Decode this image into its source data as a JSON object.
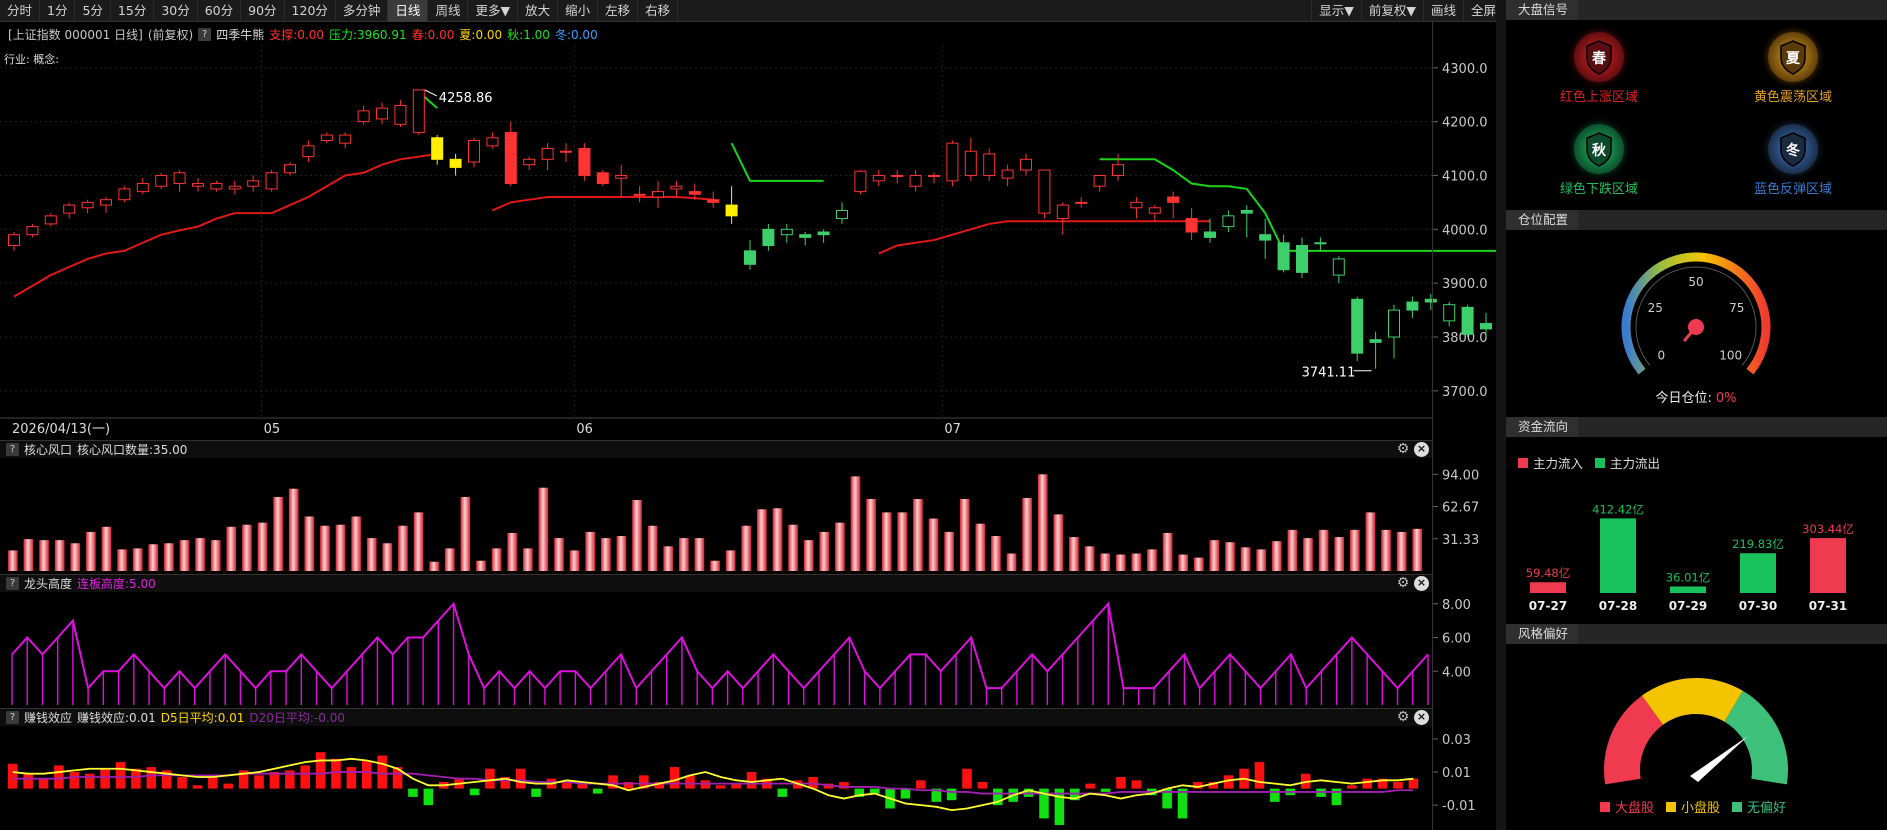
{
  "toolbar": {
    "left_buttons": [
      "分时",
      "1分",
      "5分",
      "15分",
      "30分",
      "60分",
      "90分",
      "120分",
      "多分钟",
      "日线",
      "周线",
      "更多▼",
      "放大",
      "缩小",
      "左移",
      "右移"
    ],
    "active": "日线",
    "right_buttons": [
      "显示▼",
      "前复权▼",
      "画线",
      "全屏"
    ]
  },
  "info": {
    "index": "[上证指数 000001 日线]",
    "adjust": "(前复权)",
    "help": "?",
    "indicator": "四季牛熊",
    "support": "支撑:0.00",
    "pressure": "压力:3960.91",
    "spring": "春:0.00",
    "summer": "夏:0.00",
    "autumn": "秋:1.00",
    "winter": "冬:0.00",
    "industry": "行业: 概念:"
  },
  "main_chart": {
    "y_ticks": [
      "4300.0",
      "4200.0",
      "4100.0",
      "4000.0",
      "3900.0",
      "3800.0",
      "3700.0"
    ],
    "y_vals": [
      4300,
      4200,
      4100,
      4000,
      3900,
      3800,
      3700
    ],
    "ymin": 3670,
    "ymax": 4320,
    "high_label": "4258.86",
    "low_label": "3741.11",
    "date_label": "2026/04/13(一)",
    "months": [
      "05",
      "06",
      "07"
    ],
    "month_index": [
      14,
      31,
      51
    ],
    "candles": [
      [
        3970,
        3990,
        3960,
        3995,
        "r"
      ],
      [
        3990,
        4005,
        3985,
        4010,
        "r"
      ],
      [
        4010,
        4025,
        4005,
        4030,
        "r"
      ],
      [
        4030,
        4045,
        4020,
        4050,
        "r"
      ],
      [
        4040,
        4050,
        4030,
        4055,
        "r"
      ],
      [
        4045,
        4055,
        4030,
        4060,
        "r"
      ],
      [
        4055,
        4075,
        4050,
        4080,
        "r"
      ],
      [
        4070,
        4085,
        4065,
        4095,
        "r"
      ],
      [
        4080,
        4100,
        4075,
        4105,
        "r"
      ],
      [
        4085,
        4105,
        4070,
        4110,
        "r"
      ],
      [
        4080,
        4085,
        4070,
        4095,
        "r"
      ],
      [
        4075,
        4085,
        4070,
        4090,
        "r"
      ],
      [
        4075,
        4080,
        4065,
        4090,
        "r"
      ],
      [
        4080,
        4090,
        4070,
        4100,
        "r"
      ],
      [
        4075,
        4105,
        4070,
        4110,
        "r"
      ],
      [
        4105,
        4120,
        4100,
        4125,
        "r"
      ],
      [
        4135,
        4155,
        4125,
        4165,
        "r"
      ],
      [
        4165,
        4175,
        4160,
        4180,
        "r"
      ],
      [
        4160,
        4175,
        4150,
        4180,
        "r"
      ],
      [
        4200,
        4220,
        4195,
        4230,
        "r"
      ],
      [
        4205,
        4225,
        4195,
        4235,
        "r"
      ],
      [
        4195,
        4230,
        4190,
        4240,
        "r"
      ],
      [
        4180,
        4258.86,
        4175,
        4260,
        "r"
      ],
      [
        4170,
        4130,
        4120,
        4175,
        "y"
      ],
      [
        4115,
        4130,
        4100,
        4140,
        "y"
      ],
      [
        4125,
        4165,
        4115,
        4170,
        "r"
      ],
      [
        4155,
        4170,
        4150,
        4180,
        "r"
      ],
      [
        4180,
        4085,
        4080,
        4200,
        "r"
      ],
      [
        4120,
        4130,
        4110,
        4135,
        "r"
      ],
      [
        4130,
        4150,
        4110,
        4160,
        "r"
      ],
      [
        4145,
        4145,
        4125,
        4160,
        "r"
      ],
      [
        4150,
        4100,
        4090,
        4160,
        "r"
      ],
      [
        4105,
        4085,
        4080,
        4110,
        "r"
      ],
      [
        4095,
        4100,
        4060,
        4120,
        "r"
      ],
      [
        4065,
        4065,
        4050,
        4080,
        "r"
      ],
      [
        4060,
        4070,
        4040,
        4090,
        "r"
      ],
      [
        4075,
        4080,
        4060,
        4090,
        "r"
      ],
      [
        4070,
        4065,
        4055,
        4085,
        "r"
      ],
      [
        4055,
        4050,
        4040,
        4070,
        "r"
      ],
      [
        4045,
        4025,
        4010,
        4080,
        "y"
      ],
      [
        3935,
        3960,
        3925,
        3980,
        "g"
      ],
      [
        3970,
        4000,
        3960,
        4010,
        "g"
      ],
      [
        3990,
        4000,
        3975,
        4010,
        "g"
      ],
      [
        3985,
        3990,
        3970,
        3995,
        "g"
      ],
      [
        3990,
        3995,
        3975,
        4000,
        "g"
      ],
      [
        4020,
        4035,
        4010,
        4050,
        "g"
      ],
      [
        4070,
        4108,
        4065,
        4110,
        "r"
      ],
      [
        4090,
        4100,
        4080,
        4110,
        "r"
      ],
      [
        4100,
        4100,
        4085,
        4110,
        "r"
      ],
      [
        4080,
        4100,
        4070,
        4110,
        "r"
      ],
      [
        4100,
        4100,
        4085,
        4105,
        "r"
      ],
      [
        4090,
        4160,
        4080,
        4165,
        "r"
      ],
      [
        4100,
        4145,
        4090,
        4170,
        "r"
      ],
      [
        4100,
        4140,
        4090,
        4150,
        "r"
      ],
      [
        4095,
        4110,
        4080,
        4120,
        "r"
      ],
      [
        4110,
        4130,
        4100,
        4140,
        "r"
      ],
      [
        4030,
        4110,
        4020,
        4110,
        "r"
      ],
      [
        4020,
        4045,
        3990,
        4050,
        "r"
      ],
      [
        4050,
        4050,
        4040,
        4060,
        "r"
      ],
      [
        4080,
        4100,
        4070,
        4100,
        "r"
      ],
      [
        4100,
        4120,
        4090,
        4140,
        "r"
      ],
      [
        4040,
        4050,
        4020,
        4060,
        "r"
      ],
      [
        4030,
        4040,
        4015,
        4045,
        "r"
      ],
      [
        4060,
        4050,
        4020,
        4070,
        "r"
      ],
      [
        4020,
        3995,
        3980,
        4040,
        "r"
      ],
      [
        3985,
        3995,
        3975,
        4020,
        "g"
      ],
      [
        4005,
        4025,
        3995,
        4035,
        "g"
      ],
      [
        4030,
        4035,
        3985,
        4045,
        "g"
      ],
      [
        3990,
        3980,
        3945,
        4020,
        "g"
      ],
      [
        3975,
        3925,
        3920,
        3990,
        "g"
      ],
      [
        3970,
        3920,
        3910,
        3985,
        "g"
      ],
      [
        3975,
        3975,
        3960,
        3985,
        "g"
      ],
      [
        3915,
        3945,
        3900,
        3950,
        "g"
      ],
      [
        3770,
        3870,
        3755,
        3875,
        "g"
      ],
      [
        3790,
        3795,
        3741.11,
        3810,
        "g"
      ],
      [
        3800,
        3850,
        3760,
        3860,
        "g"
      ],
      [
        3850,
        3865,
        3835,
        3875,
        "g"
      ],
      [
        3865,
        3870,
        3850,
        3880,
        "g"
      ],
      [
        3830,
        3860,
        3820,
        3865,
        "g"
      ],
      [
        3805,
        3855,
        3800,
        3860,
        "g"
      ],
      [
        3825,
        3815,
        3800,
        3845,
        "g"
      ],
      [
        3825,
        3835,
        3800,
        3845,
        "g"
      ],
      [
        3805,
        3815,
        3770,
        3830,
        "g"
      ],
      [
        3830,
        3840,
        3820,
        3850,
        "g"
      ]
    ],
    "red_line": [
      3875,
      3895,
      3915,
      3930,
      3945,
      3955,
      3960,
      3975,
      3990,
      3998,
      4005,
      4020,
      4030,
      4030,
      4030,
      4045,
      4060,
      4080,
      4100,
      4105,
      4120,
      4130,
      4135,
      4140,
      null,
      null,
      4035,
      4050,
      4055,
      4060,
      4060,
      4060,
      4060,
      4060,
      4060,
      4060,
      4060,
      4058,
      4055,
      null,
      null,
      null,
      null,
      null,
      null,
      null,
      null,
      3955,
      3970,
      3975,
      3980,
      3990,
      4000,
      4010,
      4015,
      4015,
      4015,
      4015,
      4015,
      4015,
      4015,
      4015,
      4015,
      4015,
      4015,
      4015
    ],
    "green_line": [
      null,
      null,
      null,
      null,
      null,
      null,
      null,
      null,
      null,
      null,
      null,
      null,
      null,
      null,
      null,
      null,
      null,
      null,
      null,
      null,
      null,
      null,
      4255,
      4225,
      null,
      null,
      null,
      null,
      null,
      null,
      null,
      null,
      null,
      null,
      null,
      null,
      null,
      null,
      null,
      4160,
      4090,
      4090,
      4090,
      4090,
      4090,
      null,
      null,
      null,
      null,
      null,
      null,
      null,
      null,
      null,
      null,
      null,
      null,
      null,
      null,
      4130,
      4130,
      4130,
      4130,
      4110,
      4085,
      4080,
      4080,
      4075,
      4030,
      3960,
      3960,
      3960,
      3960,
      3960,
      3960,
      3960,
      3960,
      3960,
      3960,
      3960,
      3960,
      3960,
      3958
    ]
  },
  "sub1": {
    "help": "?",
    "title": "核心风口",
    "value_label": "核心风口数量:35.00",
    "y_ticks": [
      "94.00",
      "62.67",
      "31.33"
    ],
    "y_vals": [
      94,
      62.67,
      31.33
    ],
    "ymax": 105,
    "values": [
      20,
      31,
      30,
      30,
      27,
      38,
      43,
      21,
      22,
      26,
      27,
      30,
      32,
      30,
      43,
      45,
      47,
      72,
      80,
      53,
      44,
      45,
      53,
      32,
      27,
      44,
      57,
      9,
      22,
      72,
      10,
      22,
      37,
      22,
      81,
      32,
      20,
      38,
      32,
      34,
      69,
      44,
      24,
      32,
      32,
      10,
      20,
      44,
      60,
      61,
      45,
      30,
      38,
      47,
      92,
      70,
      57,
      57,
      70,
      51,
      38,
      70,
      46,
      34,
      17,
      71,
      94,
      55,
      33,
      24,
      17,
      16,
      17,
      21,
      37,
      16,
      13,
      30,
      28,
      23,
      21,
      29,
      40,
      32,
      40,
      33,
      40,
      57,
      40,
      38,
      41
    ]
  },
  "sub2": {
    "help": "?",
    "title": "龙头高度",
    "value_label": "连板高度:5.00",
    "y_ticks": [
      "8.00",
      "6.00",
      "4.00"
    ],
    "y_vals": [
      8,
      6,
      4
    ],
    "ymin": 2,
    "ymax": 8.4,
    "values": [
      5,
      6,
      5,
      6,
      7,
      3,
      4,
      4,
      5,
      4,
      3,
      4,
      3,
      4,
      5,
      4,
      3,
      4,
      4,
      5,
      4,
      3,
      4,
      5,
      6,
      5,
      6,
      6,
      7,
      8,
      5,
      3,
      4,
      3,
      4,
      3,
      4,
      4,
      3,
      4,
      5,
      3,
      4,
      5,
      6,
      4,
      3,
      4,
      3,
      4,
      5,
      4,
      3,
      4,
      5,
      6,
      4,
      3,
      4,
      5,
      5,
      4,
      5,
      6,
      3,
      3,
      4,
      5,
      4,
      5,
      6,
      7,
      8,
      3,
      3,
      3,
      4,
      5,
      3,
      4,
      5,
      4,
      3,
      4,
      5,
      3,
      4,
      5,
      6,
      5,
      4,
      3,
      4,
      5
    ]
  },
  "sub3": {
    "help": "?",
    "title": "赚钱效应",
    "value_label": "赚钱效应:0.01",
    "d5": "D5日平均:0.01",
    "d20": "D20日平均:-0.00",
    "y_ticks": [
      "0.03",
      "0.01",
      "-0.01"
    ],
    "y_vals": [
      0.03,
      0.01,
      -0.01
    ],
    "ymin": -0.025,
    "ymax": 0.036,
    "values": [
      0.015,
      0.009,
      0.006,
      0.014,
      0.01,
      0.009,
      0.012,
      0.016,
      0.012,
      0.013,
      0.011,
      0.007,
      0.002,
      0.007,
      0.003,
      0.011,
      0.008,
      0.01,
      0.011,
      0.014,
      0.022,
      0.018,
      0.013,
      0.017,
      0.02,
      0.013,
      -0.005,
      -0.01,
      0.004,
      0.006,
      -0.004,
      0.012,
      0.007,
      0.012,
      -0.005,
      0.006,
      0.004,
      0.004,
      -0.003,
      0.008,
      0.004,
      0.008,
      0.004,
      0.013,
      0.008,
      0.005,
      0.002,
      0.003,
      0.01,
      0.006,
      -0.005,
      0.005,
      0.007,
      0.003,
      0.004,
      -0.005,
      -0.003,
      -0.012,
      -0.006,
      0.005,
      -0.008,
      -0.007,
      0.012,
      0.004,
      -0.01,
      -0.008,
      -0.005,
      -0.018,
      -0.022,
      -0.007,
      0.003,
      -0.002,
      0.007,
      0.005,
      -0.004,
      -0.012,
      -0.018,
      0.004,
      0.004,
      0.008,
      0.012,
      0.016,
      -0.008,
      -0.004,
      0.009,
      -0.005,
      -0.01,
      0.002,
      0.006,
      0.006,
      0.004,
      0.006
    ],
    "d5_line": [
      0.01,
      0.009,
      0.009,
      0.01,
      0.011,
      0.012,
      0.012,
      0.012,
      0.011,
      0.01,
      0.009,
      0.008,
      0.007,
      0.007,
      0.008,
      0.009,
      0.01,
      0.012,
      0.014,
      0.016,
      0.017,
      0.017,
      0.018,
      0.017,
      0.015,
      0.012,
      0.006,
      0.002,
      0.002,
      0.003,
      0.004,
      0.005,
      0.006,
      0.004,
      0.003,
      0.003,
      0.005,
      0.004,
      0.003,
      0.002,
      -0.001,
      0.001,
      0.003,
      0.005,
      0.008,
      0.01,
      0.007,
      0.005,
      0.004,
      0.005,
      0.006,
      0.003,
      0.0,
      -0.004,
      -0.006,
      -0.004,
      -0.003,
      -0.006,
      -0.009,
      -0.01,
      -0.011,
      -0.013,
      -0.012,
      -0.01,
      -0.008,
      -0.004,
      -0.001,
      -0.003,
      -0.005,
      -0.006,
      -0.003,
      -0.004,
      -0.006,
      -0.004,
      -0.003,
      0.0,
      0.002,
      0.001,
      0.003,
      0.005,
      0.006,
      0.004,
      0.003,
      0.002,
      0.004,
      0.005,
      0.004,
      0.003,
      0.004,
      0.005,
      0.005,
      0.006
    ],
    "d20_line": [
      0.006,
      0.006,
      0.006,
      0.006,
      0.007,
      0.007,
      0.007,
      0.007,
      0.007,
      0.008,
      0.008,
      0.008,
      0.008,
      0.008,
      0.008,
      0.009,
      0.009,
      0.009,
      0.009,
      0.009,
      0.009,
      0.01,
      0.01,
      0.01,
      0.009,
      0.009,
      0.009,
      0.008,
      0.007,
      0.006,
      0.006,
      0.005,
      0.005,
      0.005,
      0.004,
      0.004,
      0.004,
      0.003,
      0.003,
      0.003,
      0.003,
      0.003,
      0.003,
      0.003,
      0.003,
      0.003,
      0.003,
      0.003,
      0.003,
      0.003,
      0.003,
      0.003,
      0.003,
      0.002,
      0.001,
      0.001,
      0.001,
      0.0,
      0.0,
      -0.001,
      -0.001,
      -0.002,
      -0.002,
      -0.003,
      -0.003,
      -0.003,
      -0.003,
      -0.003,
      -0.003,
      -0.003,
      -0.003,
      -0.003,
      -0.002,
      -0.002,
      -0.002,
      -0.002,
      -0.002,
      -0.002,
      -0.002,
      -0.002,
      -0.002,
      -0.002,
      -0.002,
      -0.002,
      -0.002,
      -0.002,
      -0.002,
      -0.002,
      -0.002,
      -0.002,
      -0.001,
      -0.001
    ]
  },
  "right": {
    "signal_title": "大盘信号",
    "signals": [
      {
        "glyph": "春",
        "label": "红色上涨区域",
        "color": "#e02020",
        "bg": "#5a0d10"
      },
      {
        "glyph": "夏",
        "label": "黄色震荡区域",
        "color": "#e0a020",
        "bg": "#5a3a08"
      },
      {
        "glyph": "秋",
        "label": "绿色下跌区域",
        "color": "#20c060",
        "bg": "#0b4a2a"
      },
      {
        "glyph": "冬",
        "label": "蓝色反弹区域",
        "color": "#3a7ad0",
        "bg": "#1a2a40"
      }
    ],
    "position_title": "仓位配置",
    "gauge_ticks": [
      "0",
      "25",
      "50",
      "75",
      "100"
    ],
    "today_label": "今日仓位:",
    "today_value": "0%",
    "position_value": 0,
    "fund_title": "资金流向",
    "legend_in": "主力流入",
    "legend_out": "主力流出",
    "fund_bars": [
      {
        "date": "07-27",
        "value": 59.48,
        "label": "59.48亿",
        "type": "in"
      },
      {
        "date": "07-28",
        "value": 412.42,
        "label": "412.42亿",
        "type": "out"
      },
      {
        "date": "07-29",
        "value": 36.01,
        "label": "36.01亿",
        "type": "out"
      },
      {
        "date": "07-30",
        "value": 219.83,
        "label": "219.83亿",
        "type": "out"
      },
      {
        "date": "07-31",
        "value": 303.44,
        "label": "303.44亿",
        "type": "in"
      }
    ],
    "style_title": "风格偏好",
    "style_legend": [
      "大盘股",
      "小盘股",
      "无偏好"
    ],
    "style_colors": [
      "#f03a4f",
      "#f5c400",
      "#3cc07a"
    ],
    "colors": {
      "up": "#f03a4f",
      "down": "#19c15a"
    }
  }
}
